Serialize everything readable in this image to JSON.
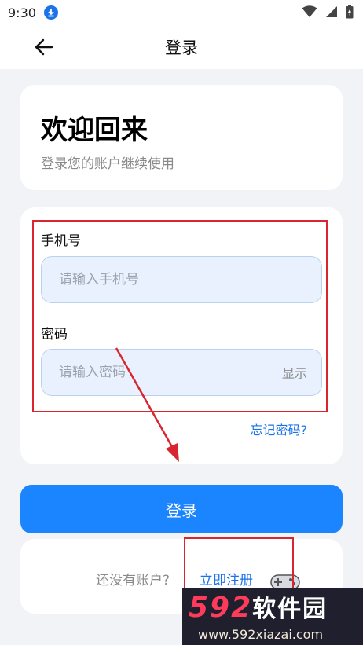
{
  "status_bar": {
    "time": "9:30"
  },
  "app_bar": {
    "title": "登录"
  },
  "welcome": {
    "title": "欢迎回来",
    "subtitle": "登录您的账户继续使用"
  },
  "form": {
    "phone_label": "手机号",
    "phone_placeholder": "请输入手机号",
    "password_label": "密码",
    "password_placeholder": "请输入密码",
    "show_label": "显示",
    "forgot_label": "忘记密码?"
  },
  "login_button": "登录",
  "register": {
    "prompt": "还没有账户?",
    "link": "立即注册"
  },
  "watermark": {
    "number": "592",
    "name": "软件园",
    "url": "www.592xiazai.com"
  },
  "colors": {
    "primary": "#1a85ff",
    "link": "#1a73e8",
    "annotation_red": "#d9262e",
    "input_bg": "#e8f1fd"
  }
}
